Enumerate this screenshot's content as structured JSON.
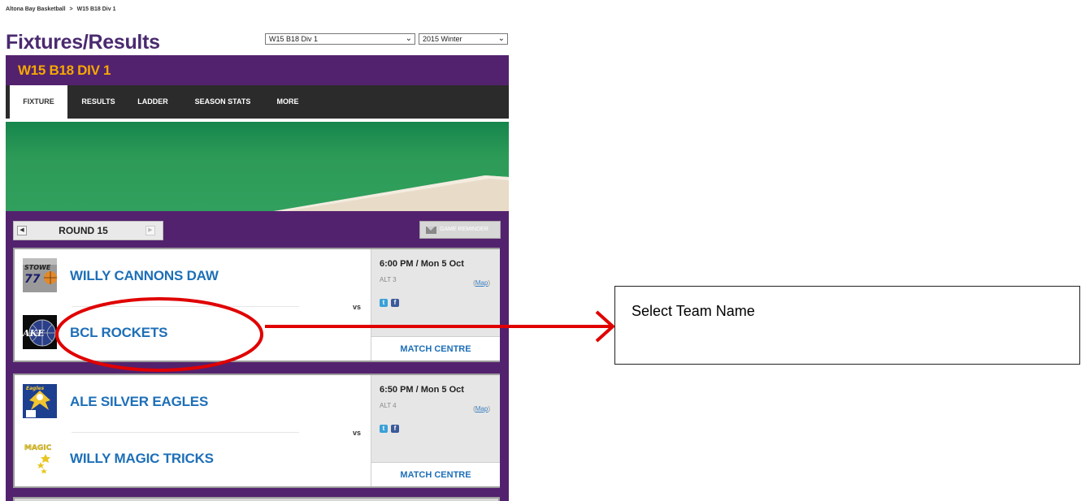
{
  "breadcrumb": {
    "club": "Altona Bay Basketball",
    "separator": ">",
    "current": "W15 B18 Div 1"
  },
  "page_title": "Fixtures/Results",
  "selects": {
    "division": "W15 B18 Div 1",
    "season": "2015 Winter"
  },
  "competition_name": "W15 B18 DIV 1",
  "tabs": [
    {
      "label": "FIXTURE",
      "active": true
    },
    {
      "label": "RESULTS"
    },
    {
      "label": "LADDER"
    },
    {
      "label": "SEASON STATS"
    },
    {
      "label": "MORE"
    }
  ],
  "round": {
    "label": "ROUND 15",
    "reminder_label": "GAME REMINDER"
  },
  "matches": [
    {
      "home": "WILLY CANNONS DAW",
      "away": "BCL ROCKETS",
      "vs": "vs",
      "time": "6:00 PM / Mon 5 Oct",
      "venue": "ALT 3",
      "map_label": "Map",
      "match_centre": "MATCH CENTRE"
    },
    {
      "home": "ALE SILVER EAGLES",
      "away": "WILLY MAGIC TRICKS",
      "vs": "vs",
      "time": "6:50 PM / Mon 5 Oct",
      "venue": "ALT 4",
      "map_label": "Map",
      "match_centre": "MATCH CENTRE"
    }
  ],
  "annotation": {
    "note": "Select Team Name",
    "color": "#e00000"
  },
  "colors": {
    "purple": "#53226e",
    "gold": "#f6a800",
    "link_blue": "#1d6fb8",
    "tab_bar": "#2b2b2b"
  }
}
